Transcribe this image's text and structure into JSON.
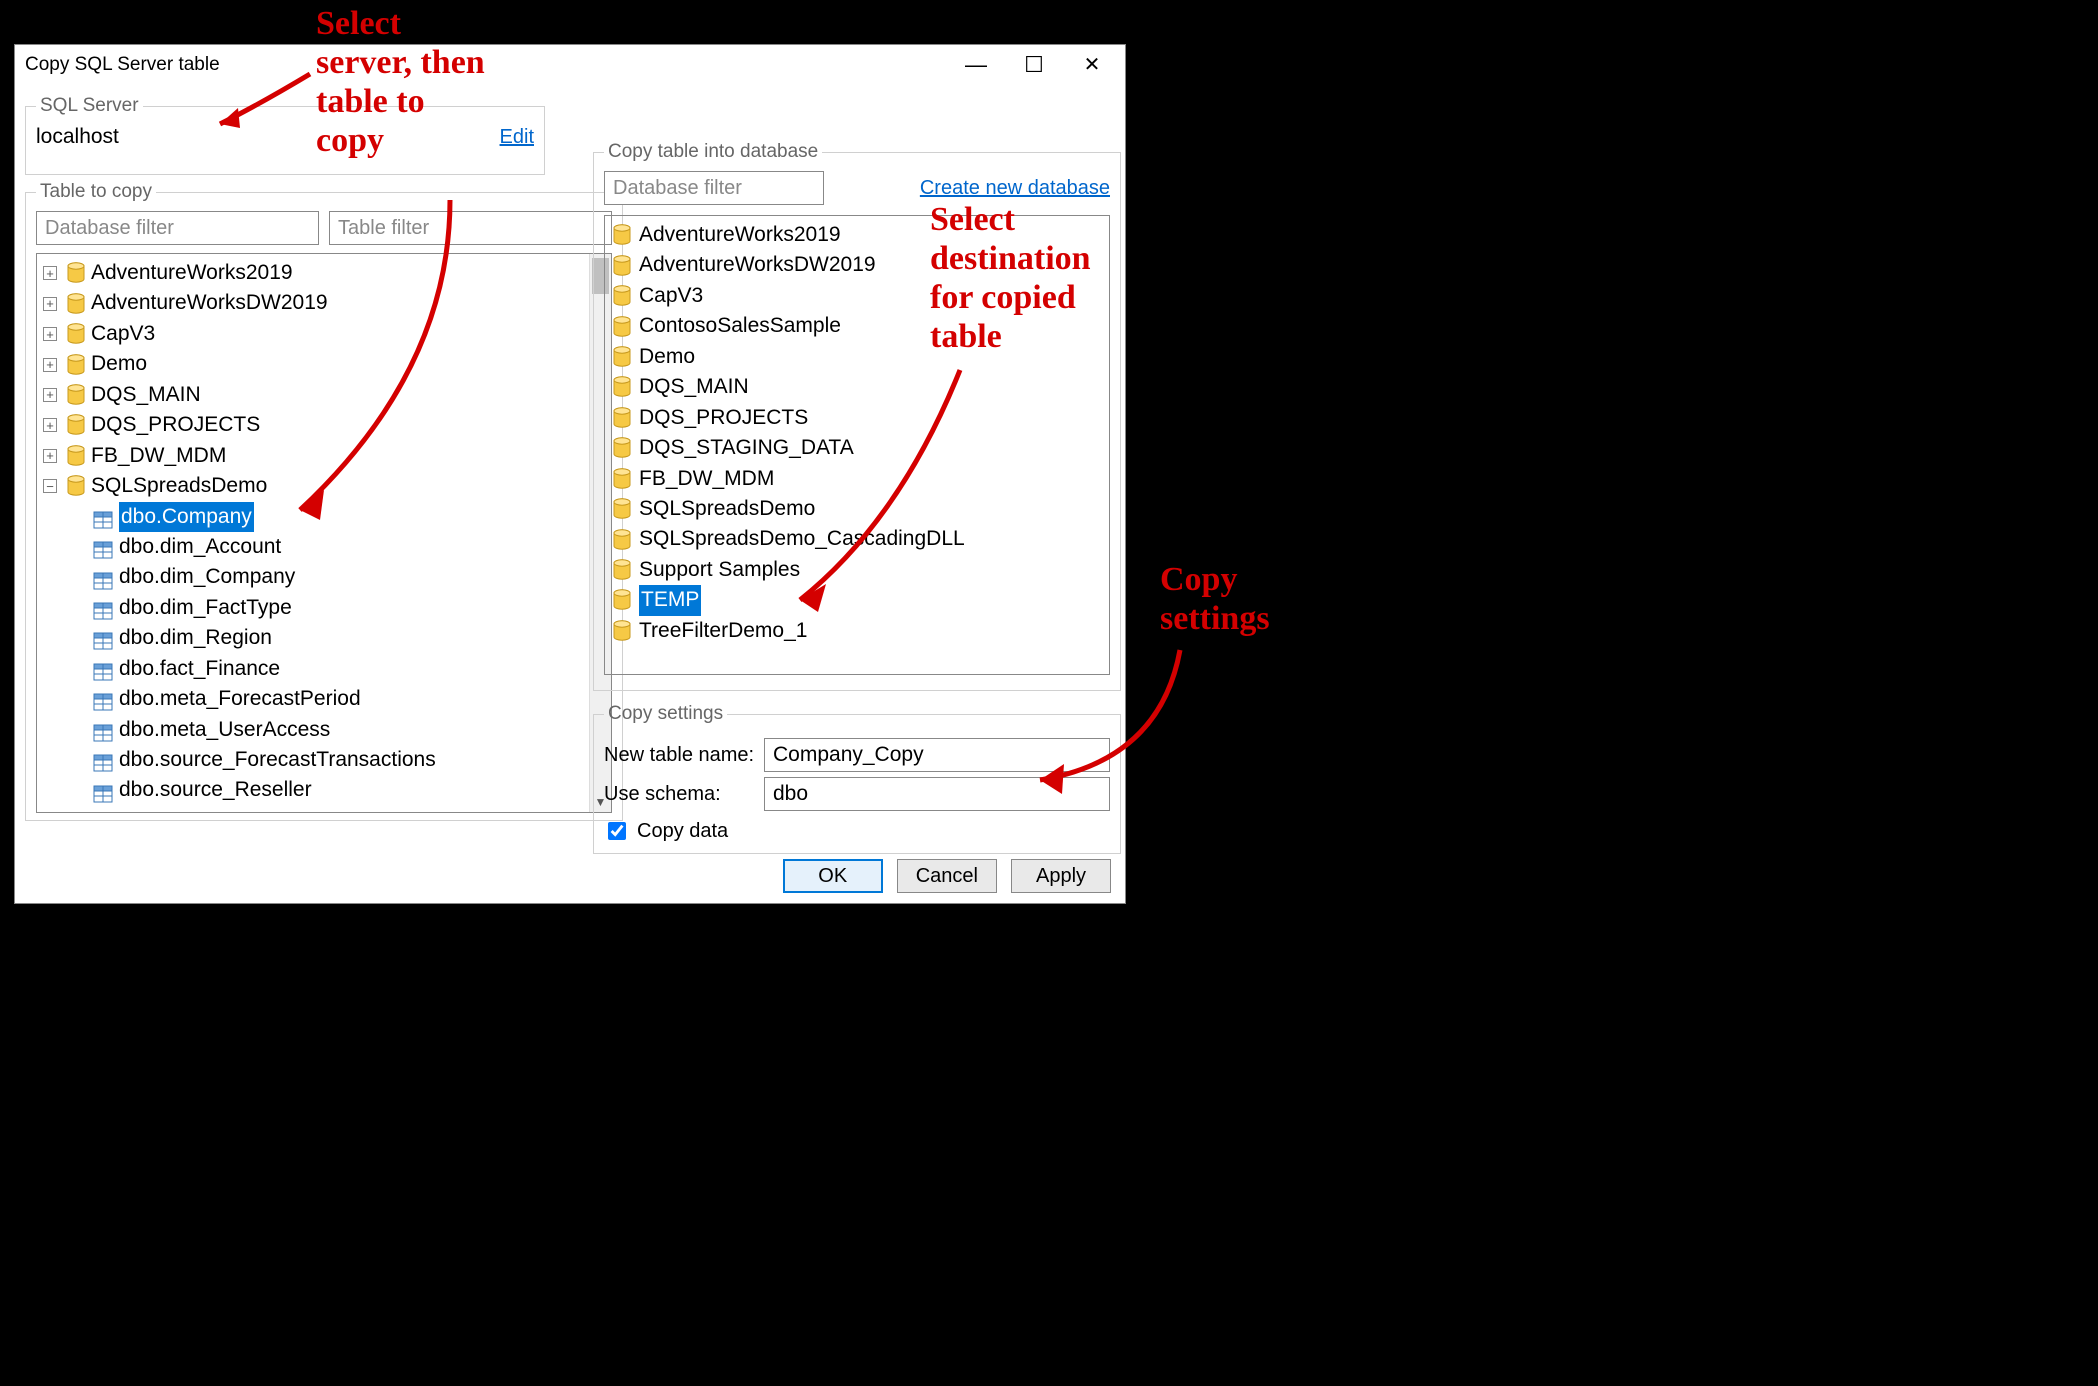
{
  "window": {
    "title": "Copy SQL Server table"
  },
  "server_section": {
    "legend": "SQL Server",
    "value": "localhost",
    "edit_link": "Edit"
  },
  "source_section": {
    "legend": "Table to copy",
    "db_filter_placeholder": "Database filter",
    "table_filter_placeholder": "Table filter",
    "databases": [
      {
        "name": "AdventureWorks2019",
        "expanded": false
      },
      {
        "name": "AdventureWorksDW2019",
        "expanded": false
      },
      {
        "name": "CapV3",
        "expanded": false
      },
      {
        "name": "Demo",
        "expanded": false
      },
      {
        "name": "DQS_MAIN",
        "expanded": false
      },
      {
        "name": "DQS_PROJECTS",
        "expanded": false
      },
      {
        "name": "FB_DW_MDM",
        "expanded": false
      },
      {
        "name": "SQLSpreadsDemo",
        "expanded": true,
        "tables": [
          {
            "name": "dbo.Company",
            "selected": true
          },
          {
            "name": "dbo.dim_Account"
          },
          {
            "name": "dbo.dim_Company"
          },
          {
            "name": "dbo.dim_FactType"
          },
          {
            "name": "dbo.dim_Region"
          },
          {
            "name": "dbo.fact_Finance"
          },
          {
            "name": "dbo.meta_ForecastPeriod"
          },
          {
            "name": "dbo.meta_UserAccess"
          },
          {
            "name": "dbo.source_ForecastTransactions"
          },
          {
            "name": "dbo.source_Reseller"
          }
        ]
      }
    ]
  },
  "dest_section": {
    "legend": "Copy table into database",
    "filter_placeholder": "Database filter",
    "create_link": "Create new database",
    "databases": [
      {
        "name": "AdventureWorks2019"
      },
      {
        "name": "AdventureWorksDW2019"
      },
      {
        "name": "CapV3"
      },
      {
        "name": "ContosoSalesSample"
      },
      {
        "name": "Demo"
      },
      {
        "name": "DQS_MAIN"
      },
      {
        "name": "DQS_PROJECTS"
      },
      {
        "name": "DQS_STAGING_DATA"
      },
      {
        "name": "FB_DW_MDM"
      },
      {
        "name": "SQLSpreadsDemo"
      },
      {
        "name": "SQLSpreadsDemo_CascadingDLL"
      },
      {
        "name": "Support Samples"
      },
      {
        "name": "TEMP",
        "selected": true
      },
      {
        "name": "TreeFilterDemo_1"
      }
    ]
  },
  "settings_section": {
    "legend": "Copy settings",
    "new_table_label": "New table name:",
    "new_table_value": "Company_Copy",
    "schema_label": "Use schema:",
    "schema_value": "dbo",
    "copy_data_label": "Copy data",
    "copy_data_checked": true
  },
  "buttons": {
    "ok": "OK",
    "cancel": "Cancel",
    "apply": "Apply"
  },
  "annotations": {
    "a1": "Select\nserver, then\ntable to\ncopy",
    "a2": "Select\ndestination\nfor copied\ntable",
    "a3": "Copy\nsettings"
  }
}
